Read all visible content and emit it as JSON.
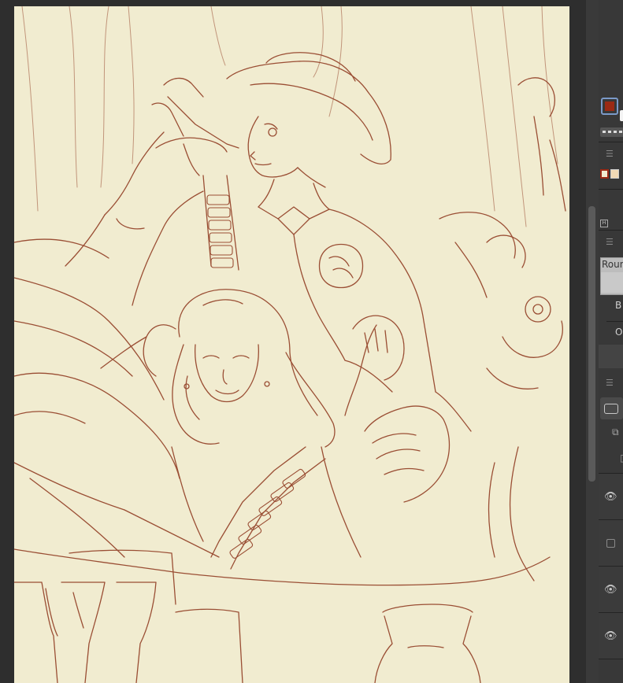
{
  "canvas": {
    "name": "sketch-canvas",
    "line_color": "#9a4e34",
    "paper_color": "#f1ecd0"
  },
  "panel": {
    "foreground_color": "#9b2a14",
    "background_color": "#f4f4f4",
    "mini_swatches": [
      "#9b2a14",
      "#f1d9b5"
    ],
    "h_badge": "H",
    "brush_name": "Roun",
    "blend_label": "B",
    "opacity_label": "O",
    "menu_icon": "☰",
    "layers": [
      {
        "icon": "eye-icon",
        "visible": true
      },
      {
        "icon": "checkbox-icon",
        "visible": false
      },
      {
        "icon": "eye-icon",
        "visible": true
      },
      {
        "icon": "eye-icon",
        "visible": true
      }
    ]
  }
}
